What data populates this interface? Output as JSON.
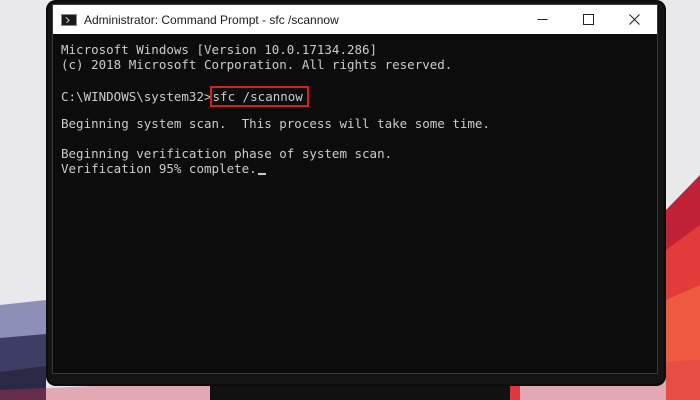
{
  "window": {
    "title": "Administrator: Command Prompt - sfc  /scannow"
  },
  "console": {
    "lines": {
      "version": "Microsoft Windows [Version 10.0.17134.286]",
      "copyright": "(c) 2018 Microsoft Corporation. All rights reserved.",
      "prompt": "C:\\WINDOWS\\system32>",
      "command": "sfc /scannow",
      "scan_begin": "Beginning system scan.  This process will take some time.",
      "verify_begin": "Beginning verification phase of system scan.",
      "verify_progress": "Verification 95% complete."
    },
    "verification_percent": 95
  },
  "colors": {
    "console_bg": "#0c0c0c",
    "console_text": "#cccccc",
    "highlight_border": "#e01b1b",
    "titlebar_bg": "#ffffff"
  },
  "icons": {
    "window": "cmd-icon",
    "minimize": "minimize-icon",
    "maximize": "maximize-icon",
    "close": "close-icon"
  }
}
